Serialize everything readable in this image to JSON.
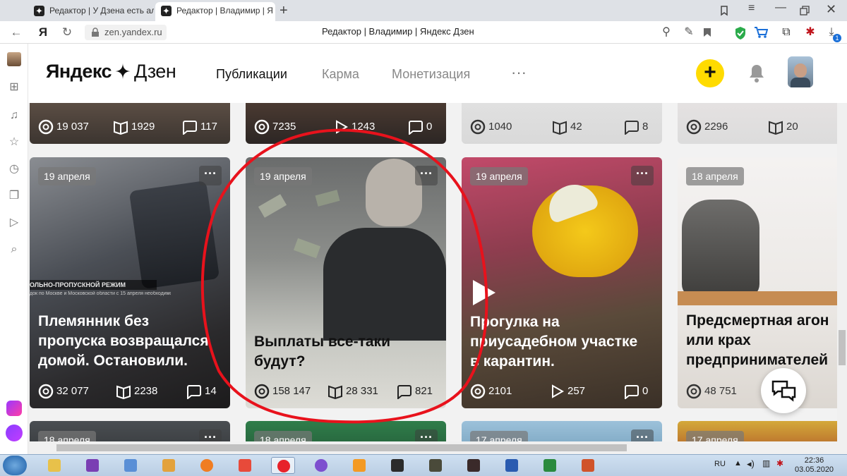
{
  "browser": {
    "tabs": [
      {
        "label": "Редактор | У Дзена есть ал",
        "active": false
      },
      {
        "label": "Редактор | Владимир | Я",
        "active": true
      }
    ],
    "new_tab_symbol": "+",
    "url": "zen.yandex.ru",
    "page_title": "Редактор | Владимир | Яндекс Дзен",
    "yandex_button": "Я",
    "download_badge": "1"
  },
  "header": {
    "logo_left": "Яндекс",
    "logo_right": "Дзен",
    "nav": [
      {
        "label": "Публикации",
        "active": true
      },
      {
        "label": "Карма",
        "active": false
      },
      {
        "label": "Монетизация",
        "active": false
      }
    ],
    "more_label": "···",
    "create_label": "+"
  },
  "top_row": [
    {
      "stats": [
        "19 037",
        "1929",
        "117"
      ],
      "second_icon": "book-icon"
    },
    {
      "stats": [
        "7235",
        "1243",
        "0"
      ],
      "second_icon": "play-icon"
    },
    {
      "stats": [
        "1040",
        "42",
        "8"
      ],
      "second_icon": "book-icon"
    },
    {
      "stats": [
        "2296",
        "20",
        ""
      ],
      "second_icon": "book-icon"
    }
  ],
  "cards": [
    {
      "date": "19 апреля",
      "title_lines": [
        "Племянник без",
        "пропуска возвращался",
        "домой. Остановили."
      ],
      "views": "32 077",
      "reads": "2238",
      "comments": "14",
      "second_icon": "book-icon"
    },
    {
      "date": "19 апреля",
      "title_lines": [
        "Выплаты все-таки",
        "будут?"
      ],
      "views": "158 147",
      "reads": "28 331",
      "comments": "821",
      "second_icon": "book-icon"
    },
    {
      "date": "19 апреля",
      "title_lines": [
        "Прогулка на",
        "приусадебном участке",
        "в карантин."
      ],
      "views": "2101",
      "reads": "257",
      "comments": "0",
      "second_icon": "play-icon"
    },
    {
      "date": "18 апреля",
      "title_lines": [
        "Предсмертная агон",
        "или крах",
        "предпринимателей"
      ],
      "views": "48 751",
      "reads": "",
      "comments": "",
      "second_icon": "book-icon"
    }
  ],
  "bottom_row": [
    {
      "date": "18 апреля"
    },
    {
      "date": "18 апреля"
    },
    {
      "date": "17 апреля"
    },
    {
      "date": "17 апреля"
    }
  ],
  "card_more": "···",
  "image_caption": "ОЛЬНО-ПРОПУСКНОЙ РЕЖИМ",
  "image_caption_sub": "док по Москве и Московской области с 15 апреля необходимо",
  "taskbar": {
    "lang": "RU",
    "time": "22:36",
    "date": "03.05.2020"
  },
  "colors": {
    "accent_yellow": "#ffdb00",
    "annotation_red": "#e8121c"
  }
}
